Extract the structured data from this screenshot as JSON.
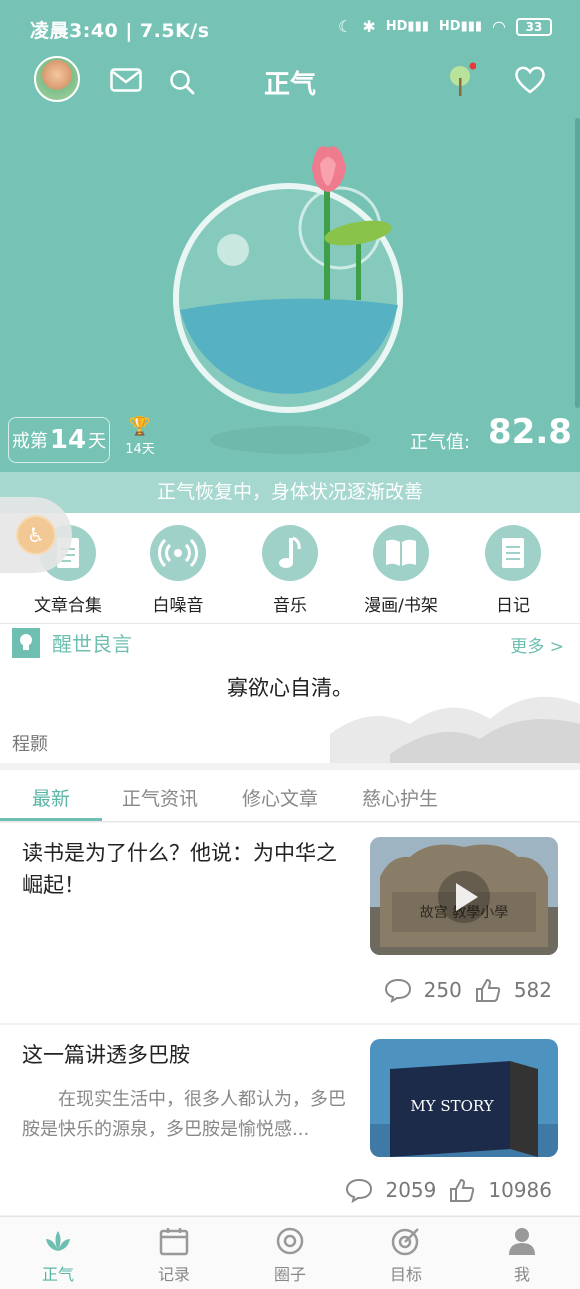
{
  "status_bar": {
    "time": "凌晨3:40 | 7.5K/s",
    "signal_1": "HD",
    "signal_2": "HD",
    "battery": "33"
  },
  "header": {
    "title": "正气"
  },
  "hero": {
    "quit_prefix": "戒第",
    "quit_days": "14",
    "quit_suffix": "天",
    "trophy_days": "14天",
    "score_label": "正气值:",
    "score_value": "82.8",
    "recovery_message": "正气恢复中，身体状况逐渐改善"
  },
  "quick_nav": [
    {
      "label": "文章合集",
      "icon": "document-icon"
    },
    {
      "label": "白噪音",
      "icon": "broadcast-icon"
    },
    {
      "label": "音乐",
      "icon": "music-note-icon"
    },
    {
      "label": "漫画/书架",
      "icon": "book-icon"
    },
    {
      "label": "日记",
      "icon": "diary-icon"
    }
  ],
  "quote": {
    "heading": "醒世良言",
    "more": "更多 >",
    "text": "寡欲心自清。",
    "author": "程颢"
  },
  "tabs": [
    "最新",
    "正气资讯",
    "修心文章",
    "慈心护生"
  ],
  "articles": [
    {
      "title": "读书是为了什么？他说：为中华之崛起！",
      "summary": "",
      "comments": "250",
      "likes": "582",
      "thumb_text": "故宫 教學小學"
    },
    {
      "title": "这一篇讲透多巴胺",
      "summary": "在现实生活中，很多人都认为，多巴胺是快乐的源泉，多巴胺是愉悦感...",
      "comments": "2059",
      "likes": "10986",
      "thumb_text": "MY STORY"
    }
  ],
  "bottom_nav": [
    {
      "label": "正气",
      "icon": "lotus-icon"
    },
    {
      "label": "记录",
      "icon": "calendar-icon"
    },
    {
      "label": "圈子",
      "icon": "circle-icon"
    },
    {
      "label": "目标",
      "icon": "target-icon"
    },
    {
      "label": "我",
      "icon": "person-icon"
    }
  ],
  "colors": {
    "teal": "#76c3b6",
    "accent": "#6ebfb1",
    "light_teal": "#a6d8cf"
  }
}
